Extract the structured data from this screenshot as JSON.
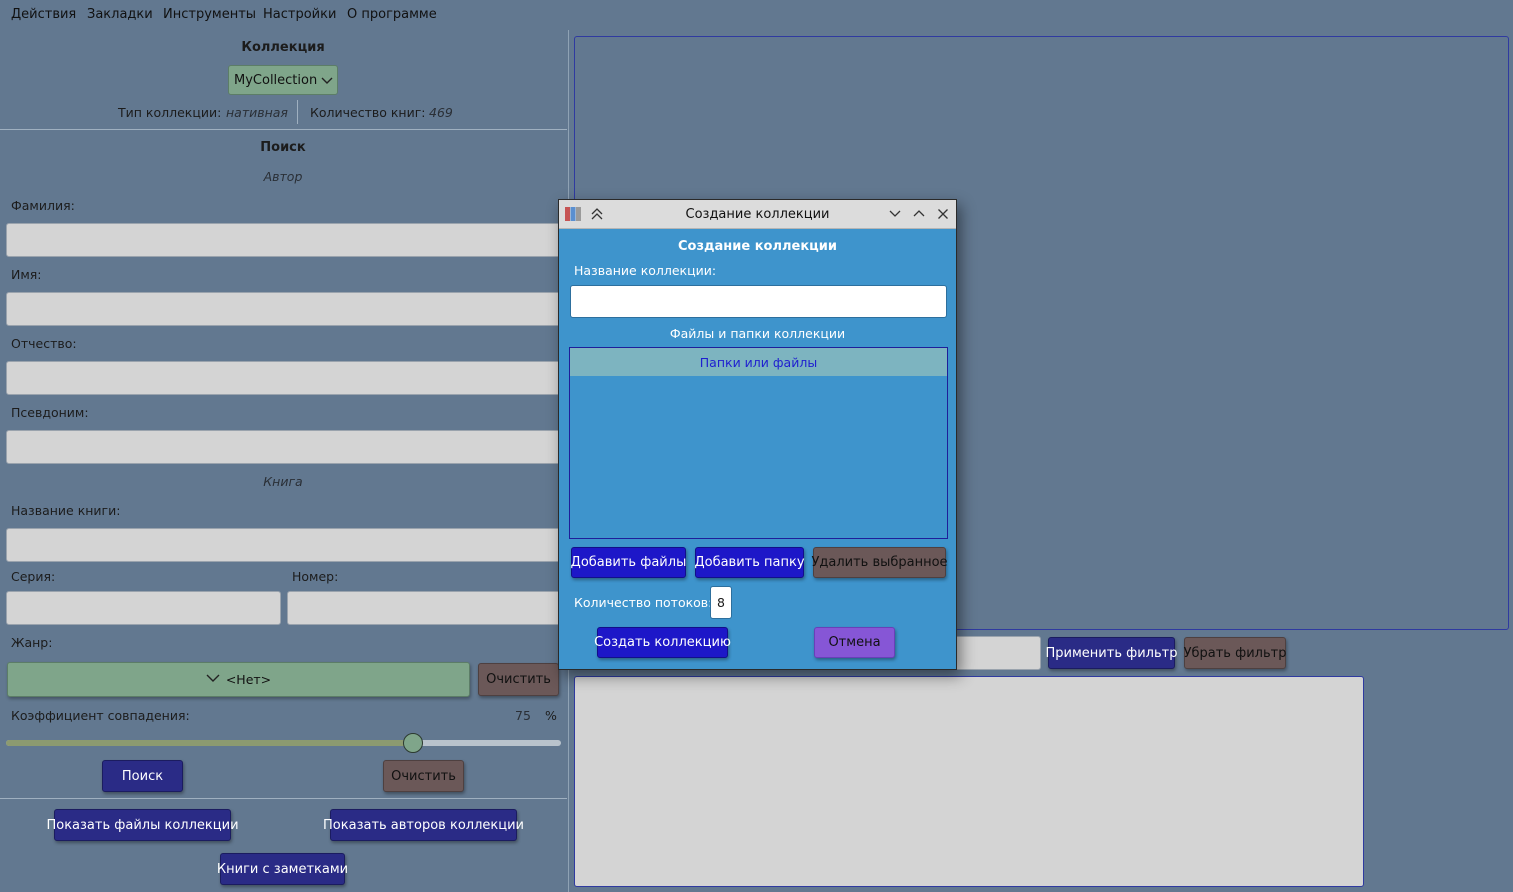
{
  "menu": [
    "Действия",
    "Закладки",
    "Инструменты",
    "Настройки",
    "О программе"
  ],
  "collection": {
    "title": "Коллекция",
    "selected": "MyCollection",
    "type_label": "Тип коллекции:",
    "type_value": "нативная",
    "count_label": "Количество книг:",
    "count_value": "469"
  },
  "search": {
    "title": "Поиск",
    "author_section": "Автор",
    "surname_label": "Фамилия:",
    "name_label": "Имя:",
    "patronymic_label": "Отчество:",
    "pseudonym_label": "Псевдоним:",
    "book_section": "Книга",
    "book_title_label": "Название книги:",
    "series_label": "Серия:",
    "number_label": "Номер:",
    "genre_label": "Жанр:",
    "genre_value": "<Нет>",
    "genre_clear": "Очистить",
    "match_label": "Коэффициент совпадения:",
    "match_value": "75",
    "match_unit": "%",
    "match_fraction": 0.75,
    "search_button": "Поиск",
    "clear_button": "Очистить"
  },
  "bottom_buttons": {
    "show_files": "Показать файлы коллекции",
    "show_authors": "Показать авторов коллекции",
    "books_with_notes": "Книги с заметками"
  },
  "filter": {
    "apply": "Применить фильтр",
    "remove": "Убрать фильтр"
  },
  "dialog": {
    "window_title": "Создание коллекции",
    "heading": "Создание коллекции",
    "name_label": "Название коллекции:",
    "name_value": "",
    "files_label": "Файлы и папки коллекции",
    "list_header": "Папки или файлы",
    "add_files": "Добавить файлы",
    "add_folder": "Добавить папку",
    "remove_selected": "Удалить выбранное",
    "threads_label": "Количество потоков:",
    "threads_value": "8",
    "create": "Создать коллекцию",
    "cancel": "Отмена"
  },
  "colors": {
    "background": "#627890",
    "dialog": "#3e94cc",
    "navy_button": "#2a2b86",
    "brown_button": "#6b5858",
    "blue_button": "#1d17c8",
    "purple_button": "#8656d6",
    "combo_green": "#7fa58a"
  }
}
